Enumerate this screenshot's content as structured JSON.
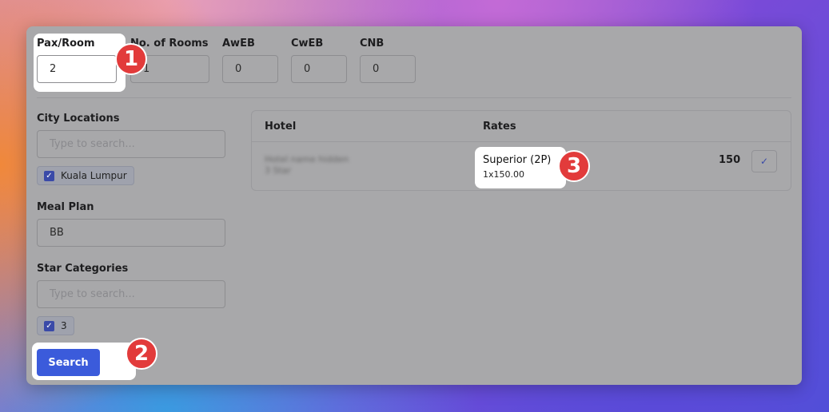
{
  "occupancy": {
    "pax_room": {
      "label": "Pax/Room",
      "value": "2"
    },
    "rooms": {
      "label": "No. of Rooms",
      "value": "1"
    },
    "aweb": {
      "label": "AwEB",
      "value": "0"
    },
    "cweb": {
      "label": "CwEB",
      "value": "0"
    },
    "cnb": {
      "label": "CNB",
      "value": "0"
    }
  },
  "filters": {
    "city": {
      "label": "City Locations",
      "placeholder": "Type to search...",
      "selected": "Kuala Lumpur"
    },
    "meal": {
      "label": "Meal Plan",
      "value": "BB"
    },
    "stars": {
      "label": "Star Categories",
      "placeholder": "Type to search...",
      "selected": "3"
    },
    "search_label": "Search"
  },
  "results": {
    "headers": [
      "Hotel",
      "Rates"
    ],
    "rows": [
      {
        "hotel": "Hotel name hidden",
        "hotel_sub": "3 Star",
        "rate_name": "Superior (2P)",
        "rate_detail": "1x150.00",
        "price": "150"
      }
    ]
  },
  "callouts": [
    "1",
    "2",
    "3"
  ],
  "colors": {
    "accent": "#3b5bdb",
    "badge": "#e23b3b"
  }
}
